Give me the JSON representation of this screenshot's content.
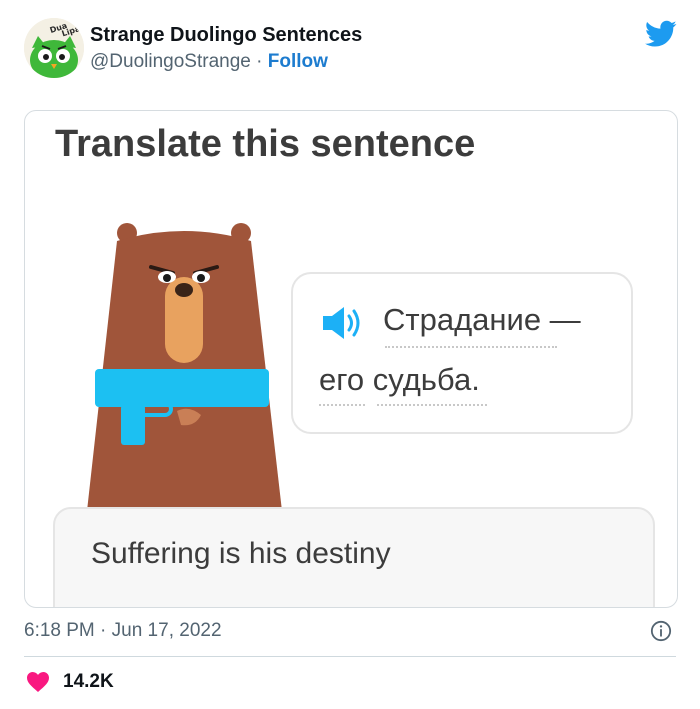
{
  "author": {
    "name": "Strange Duolingo Sentences",
    "handle": "@DuolingoStrange",
    "separator": "·",
    "follow_label": "Follow",
    "avatar_text": "Dua Lipa"
  },
  "media": {
    "prompt_title": "Translate this sentence",
    "source_line1": "Страдание —",
    "source_line2": "его судьба.",
    "answer": "Suffering is his destiny"
  },
  "meta": {
    "timestamp": "6:18 PM · Jun 17, 2022"
  },
  "engagement": {
    "likes": "14.2K"
  },
  "colors": {
    "twitter_blue": "#1d9bf0",
    "follow_blue": "#1d7ccf",
    "heart": "#f91880",
    "bear_brown": "#a0553a",
    "gun_blue": "#1cc0f2"
  },
  "icons": {
    "brand": "twitter-bird-icon",
    "info": "info-icon",
    "like": "heart-icon",
    "audio": "speaker-icon"
  }
}
